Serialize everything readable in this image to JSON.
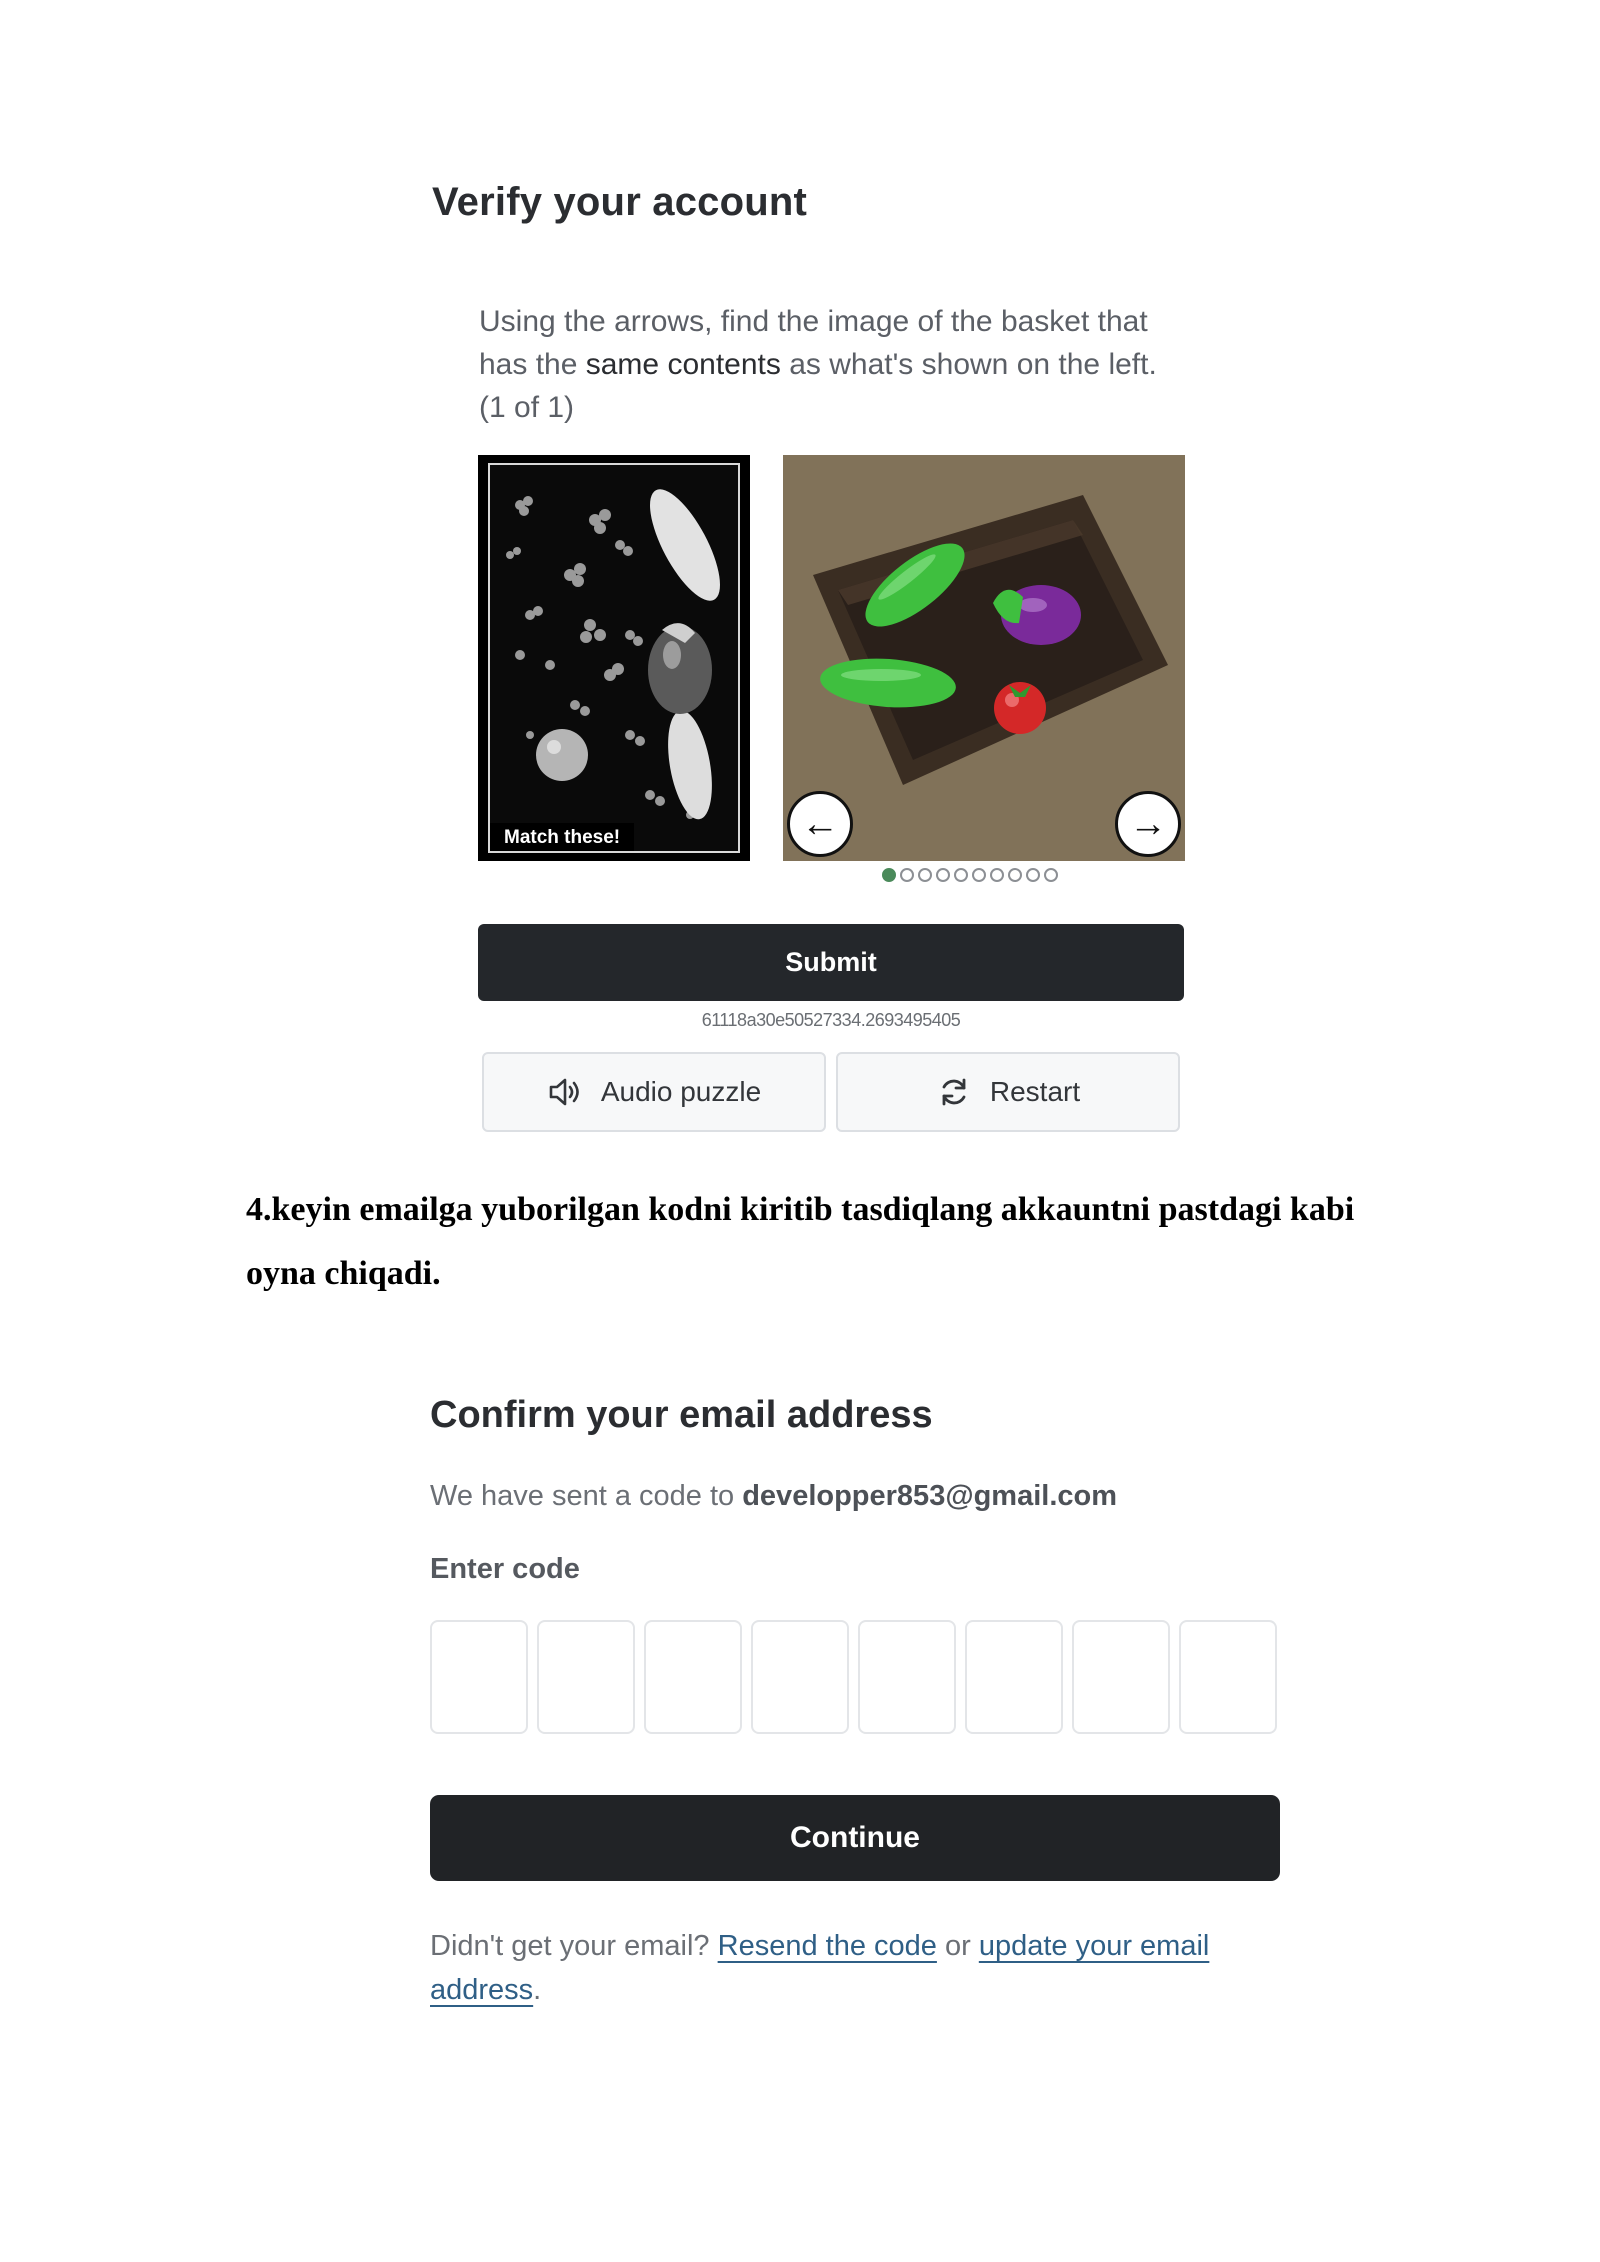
{
  "verify": {
    "title": "Verify your account",
    "instruction_part1": "Using the arrows, find the image of the basket that has the ",
    "instruction_emphasis": "same contents",
    "instruction_part2": " as what's shown on the left.",
    "progress": "(1 of 1)",
    "match_label": "Match these!",
    "carousel": {
      "total_dots": 10,
      "active_index": 0,
      "active_color": "#4a8a5a"
    },
    "submit_label": "Submit",
    "session_id": "61118a30e50527334.2693495405",
    "audio_label": "Audio puzzle",
    "restart_label": "Restart"
  },
  "document": {
    "paragraph": "4.keyin emailga yuborilgan kodni kiritib tasdiqlang akkauntni pastdagi kabi oyna chiqadi."
  },
  "confirm": {
    "title": "Confirm your email address",
    "sent_prefix": "We have sent a code to ",
    "email": "developper853@gmail.com",
    "code_label": "Enter code",
    "code_boxes": 8,
    "continue_label": "Continue",
    "resend_prefix": "Didn't get your email? ",
    "resend_link": "Resend the code",
    "or_text": " or ",
    "update_link": "update your email address",
    "period": "."
  },
  "colors": {
    "button_dark": "#24272b",
    "link": "#2f5f86",
    "eggplant": "#7a2a9a",
    "cucumber": "#3fbf3f",
    "tomato": "#d42828"
  },
  "icons": {
    "left_arrow": "arrow-left-icon",
    "right_arrow": "arrow-right-icon",
    "audio": "speaker-icon",
    "restart": "refresh-icon"
  }
}
